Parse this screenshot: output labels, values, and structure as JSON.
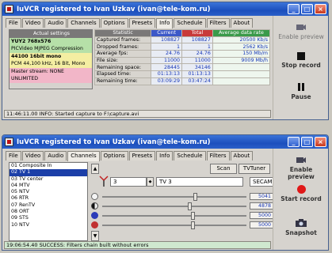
{
  "window1": {
    "title": "IuVCR registered to Ivan Uzkav (ivan@tele-kom.ru)",
    "tabs": [
      "File",
      "Video",
      "Audio",
      "Channels",
      "Options",
      "Presets",
      "Info",
      "Schedule",
      "Filters",
      "About"
    ],
    "selected_tab": "Info",
    "info_lines": [
      "Actual settings",
      "YUY2 768x576",
      "PICVideo MJPEG Compression",
      "44100 16bit mono",
      "PCM 44,100 kHz, 16 Bit, Mono",
      "Master stream: NONE",
      "UNLIMITED"
    ],
    "stats": {
      "headers": [
        "Statistic",
        "Current",
        "Total",
        "Average data rate"
      ],
      "rows": [
        [
          "Captured frames:",
          "108827",
          "108827",
          "20500 Kb/s"
        ],
        [
          "Dropped frames:",
          "1",
          "1",
          "2562 Kb/s"
        ],
        [
          "Average fps:",
          "24.76",
          "24.76",
          "150 Mb/m"
        ],
        [
          "File size:",
          "11000",
          "11000",
          "9009 Mb/h"
        ],
        [
          "Remaining space:",
          "28445",
          "34146",
          ""
        ],
        [
          "Elapsed time:",
          "01:13:13",
          "01:13:13",
          ""
        ],
        [
          "Remaining time:",
          "03:09:29",
          "03:47:24",
          ""
        ]
      ]
    },
    "buttons": {
      "preview": "Enable preview",
      "stop": "Stop record",
      "pause": "Pause"
    },
    "status": "11:46:11.00 INFO: Started capture to F:\\capture.avi"
  },
  "window2": {
    "title": "IuVCR registered to Ivan Uzkav (ivan@tele-kom.ru)",
    "tabs": [
      "File",
      "Video",
      "Audio",
      "Channels",
      "Options",
      "Presets",
      "Info",
      "Schedule",
      "Filters",
      "About"
    ],
    "selected_tab": "Channels",
    "channels": [
      "01 Composite In",
      "02 TV 1",
      "03 TV center",
      "04 MTV",
      "05 NTV",
      "06 RTR",
      "07 RenTV",
      "08 ORT",
      "09 STS",
      "10 NTV"
    ],
    "selected_channel": "02 TV 1",
    "scan": "Scan",
    "tvtuner": "TVTuner",
    "channel_num": "3",
    "channel_name": "TV 3",
    "standard": "SECAM D",
    "sliders": [
      {
        "icon": "brightness",
        "value": "5041",
        "pos": 0.64,
        "color": "#f2f2f2"
      },
      {
        "icon": "contrast",
        "value": "4878",
        "pos": 0.6,
        "color": "#222222"
      },
      {
        "icon": "hue",
        "value": "5000",
        "pos": 0.62,
        "color": "#2a3ab8"
      },
      {
        "icon": "saturation",
        "value": "5000",
        "pos": 0.62,
        "color": "#c03030"
      }
    ],
    "buttons": {
      "preview": "Enable preview",
      "start": "Start record",
      "snapshot": "Snapshot"
    },
    "status": "19:06:54.40 SUCCESS: Filters chain built without errors"
  }
}
